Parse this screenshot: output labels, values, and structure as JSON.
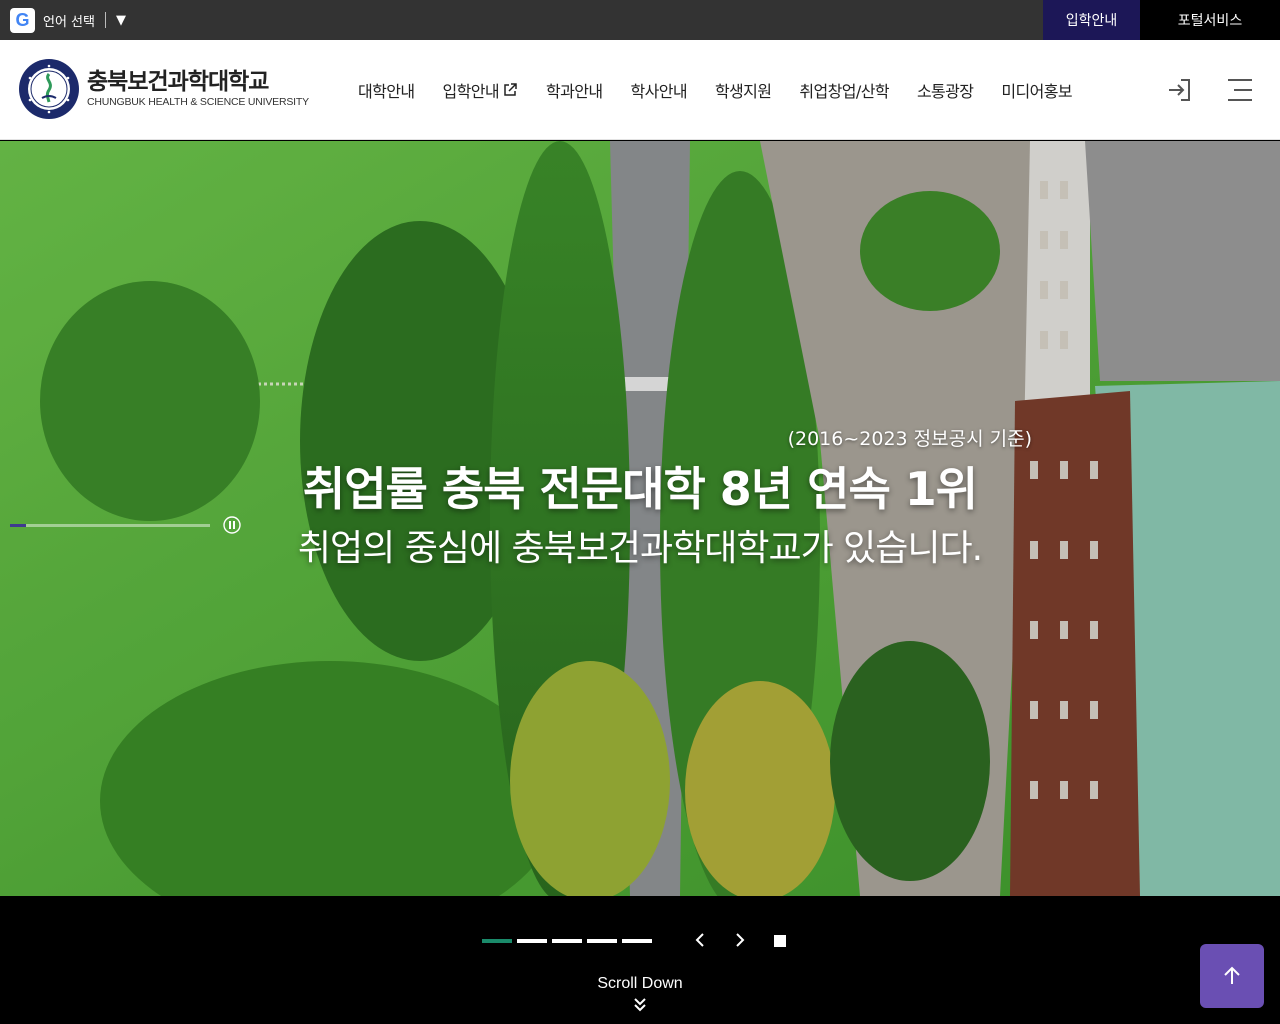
{
  "topbar": {
    "language_label": "언어 선택",
    "admission_link": "입학안내",
    "portal_link": "포털서비스"
  },
  "header": {
    "logo_korean": "충북보건과학대학교",
    "logo_english": "CHUNGBUK HEALTH & SCIENCE UNIVERSITY",
    "nav": [
      "대학안내",
      "입학안내",
      "학과안내",
      "학사안내",
      "학생지원",
      "취업창업/산학",
      "소통광장",
      "미디어홍보"
    ]
  },
  "hero": {
    "note": "(2016~2023 정보공시 기준)",
    "title": "취업률 충북 전문대학 8년 연속 1위",
    "subtitle": "취업의 중심에 충북보건과학대학교가 있습니다.",
    "video_progress": 0.08
  },
  "slider": {
    "slide_count": 5,
    "active_index": 0
  },
  "footer_controls": {
    "scroll_label": "Scroll Down"
  },
  "colors": {
    "topbar_bg": "#333333",
    "admission_bg": "#1c1757",
    "active_dot": "#1a8a6a",
    "top_button": "#6a4fb3"
  }
}
